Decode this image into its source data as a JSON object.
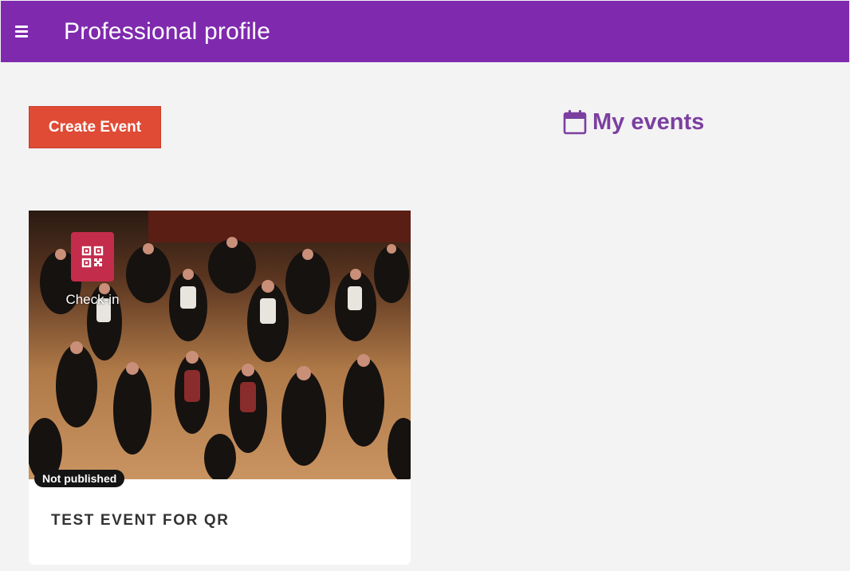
{
  "header": {
    "title": "Professional profile",
    "menu_icon": "hamburger-menu-icon",
    "background": "#7f2aae"
  },
  "actions": {
    "create_event_label": "Create Event",
    "create_event_color": "#e04b35"
  },
  "events_section": {
    "heading": "My events",
    "icon": "calendar-icon",
    "color": "#7b3fa0"
  },
  "events": [
    {
      "title": "TEST EVENT FOR QR",
      "status": "Not published",
      "checkin_label": "Check-in",
      "checkin_icon": "qr-code-icon",
      "image": "dance-floor-photo"
    }
  ]
}
